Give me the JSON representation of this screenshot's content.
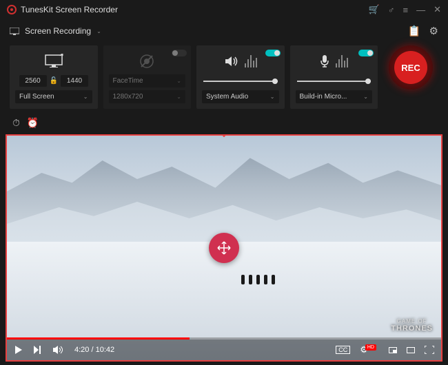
{
  "titlebar": {
    "title": "TunesKit Screen Recorder"
  },
  "mode": {
    "label": "Screen Recording"
  },
  "display": {
    "width": "2560",
    "height": "1440",
    "preset": "Full Screen"
  },
  "camera": {
    "device": "FaceTime",
    "resolution": "1280x720",
    "enabled": false
  },
  "systemAudio": {
    "label": "System Audio",
    "enabled": true
  },
  "mic": {
    "label": "Build-in Micro...",
    "enabled": true
  },
  "rec": {
    "label": "REC"
  },
  "video": {
    "current": "4:20",
    "total": "10:42",
    "watermarkTop": "GAME OF",
    "watermarkBottom": "THRONES",
    "cc": "CC",
    "hd": "HD"
  }
}
